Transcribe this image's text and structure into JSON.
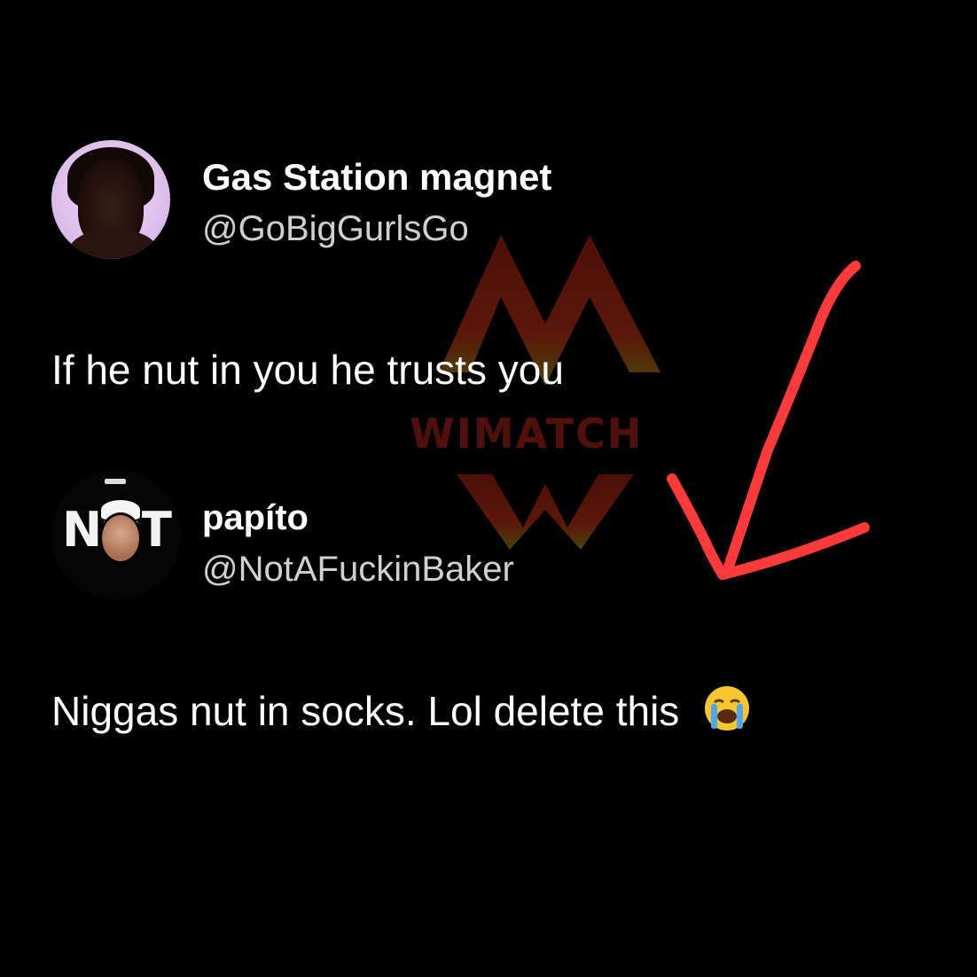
{
  "tweet_original": {
    "display_name": "Gas Station magnet",
    "handle": "@GoBigGurlsGo",
    "text": "If he nut in you he trusts you"
  },
  "tweet_reply": {
    "display_name": "papíto",
    "handle": "@NotAFuckinBaker",
    "text": "Niggas nut in socks. Lol delete this",
    "emoji": "loudly-crying-face-emoji",
    "avatar_logo_text": "NOT"
  },
  "watermark": {
    "text": "WIMATCH",
    "color": "#8a1e12"
  },
  "annotation": {
    "icon": "red-arrow-icon",
    "color": "#ff3a3a"
  },
  "theme": {
    "background": "#000000",
    "name_color": "#ffffff",
    "handle_color": "#d0d0d0"
  }
}
